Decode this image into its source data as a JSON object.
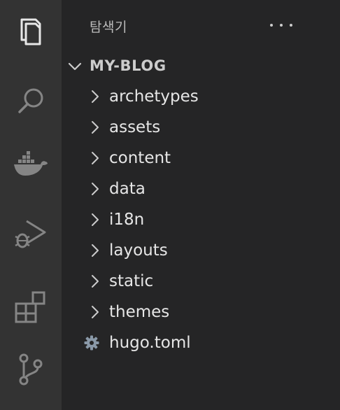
{
  "activity_bar": {
    "items": [
      {
        "name": "explorer",
        "icon": "files-icon"
      },
      {
        "name": "search",
        "icon": "search-icon"
      },
      {
        "name": "docker",
        "icon": "docker-icon"
      },
      {
        "name": "run-debug",
        "icon": "run-debug-icon"
      },
      {
        "name": "extensions",
        "icon": "extensions-icon"
      },
      {
        "name": "source-control",
        "icon": "source-control-icon"
      }
    ]
  },
  "sidebar": {
    "title": "탐색기",
    "more_icon": "ellipsis-icon",
    "folder": {
      "name": "MY-BLOG",
      "expanded": true
    },
    "items": [
      {
        "label": "archetypes",
        "type": "folder"
      },
      {
        "label": "assets",
        "type": "folder"
      },
      {
        "label": "content",
        "type": "folder"
      },
      {
        "label": "data",
        "type": "folder"
      },
      {
        "label": "i18n",
        "type": "folder"
      },
      {
        "label": "layouts",
        "type": "folder"
      },
      {
        "label": "static",
        "type": "folder"
      },
      {
        "label": "themes",
        "type": "folder"
      },
      {
        "label": "hugo.toml",
        "type": "file",
        "icon": "gear-icon"
      }
    ]
  },
  "colors": {
    "activity_bar_bg": "#333333",
    "sidebar_bg": "#252526",
    "active_icon": "#e7e7e7",
    "inactive_icon": "#858585",
    "text": "#e6e6e6"
  }
}
